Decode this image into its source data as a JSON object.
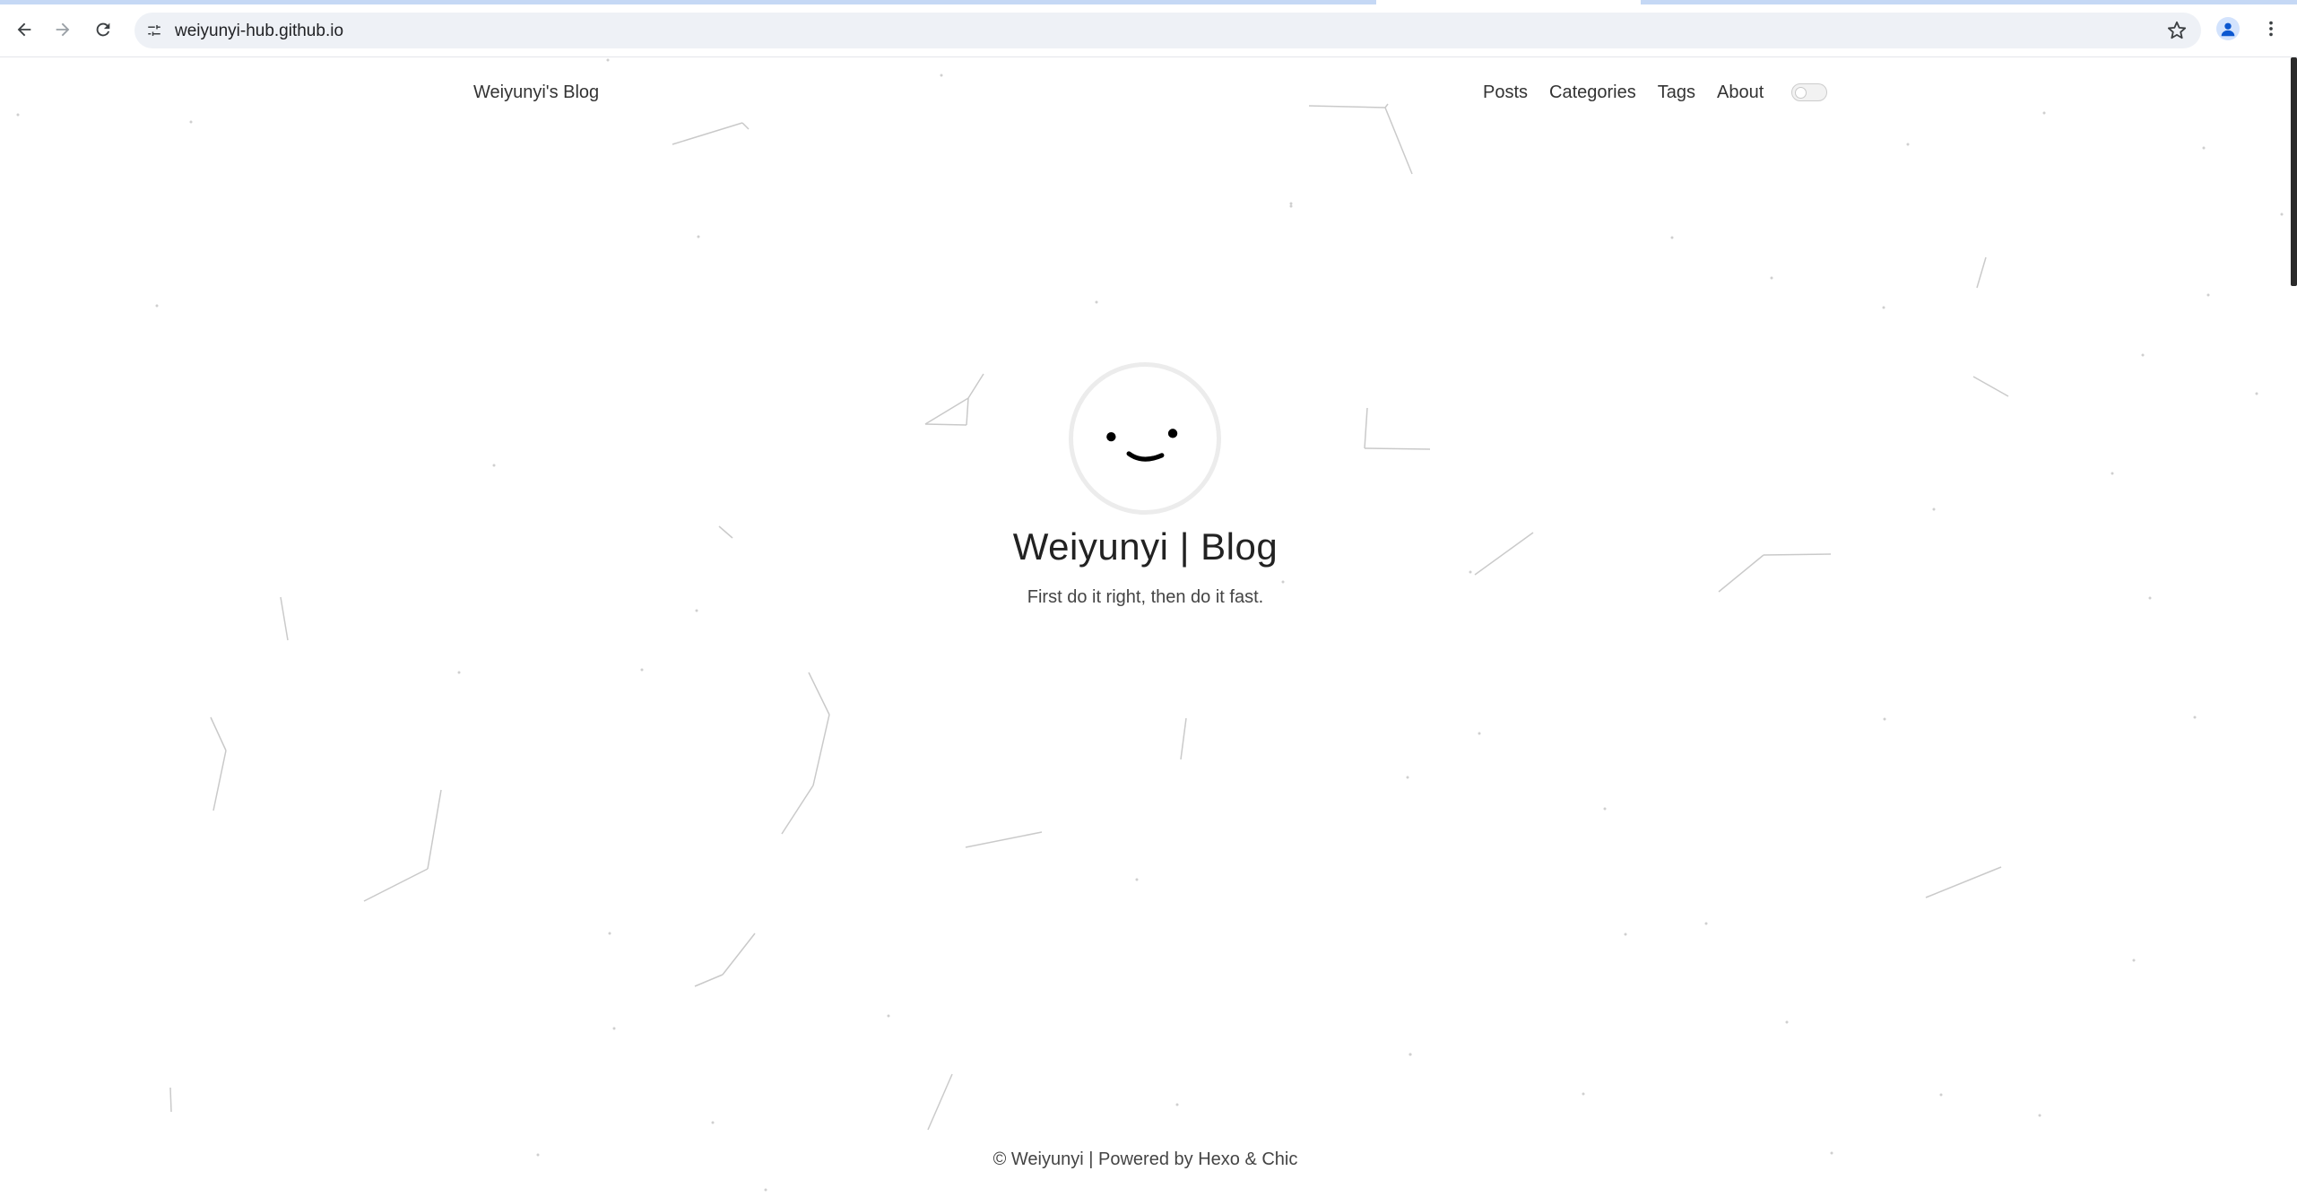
{
  "browser": {
    "url": "weiyunyi-hub.github.io",
    "icons": {
      "back": "arrow-left-icon",
      "forward": "arrow-right-icon",
      "reload": "reload-icon",
      "site_info": "tune-icon",
      "bookmark": "star-icon",
      "profile": "person-icon",
      "menu": "kebab-menu-icon"
    }
  },
  "header": {
    "brand": "Weiyunyi's Blog",
    "nav": [
      {
        "label": "Posts"
      },
      {
        "label": "Categories"
      },
      {
        "label": "Tags"
      },
      {
        "label": "About"
      }
    ],
    "theme_toggle_on": false
  },
  "hero": {
    "title": "Weiyunyi | Blog",
    "subtitle": "First do it right, then do it fast."
  },
  "footer": {
    "copyright": "© Weiyunyi |",
    "powered_by": "Powered by",
    "hexo": "Hexo",
    "amp": "&",
    "chic": "Chic"
  },
  "colors": {
    "text": "#333333",
    "omnibox_bg": "#eef1f6",
    "particle_line": "#bdbdbd"
  }
}
